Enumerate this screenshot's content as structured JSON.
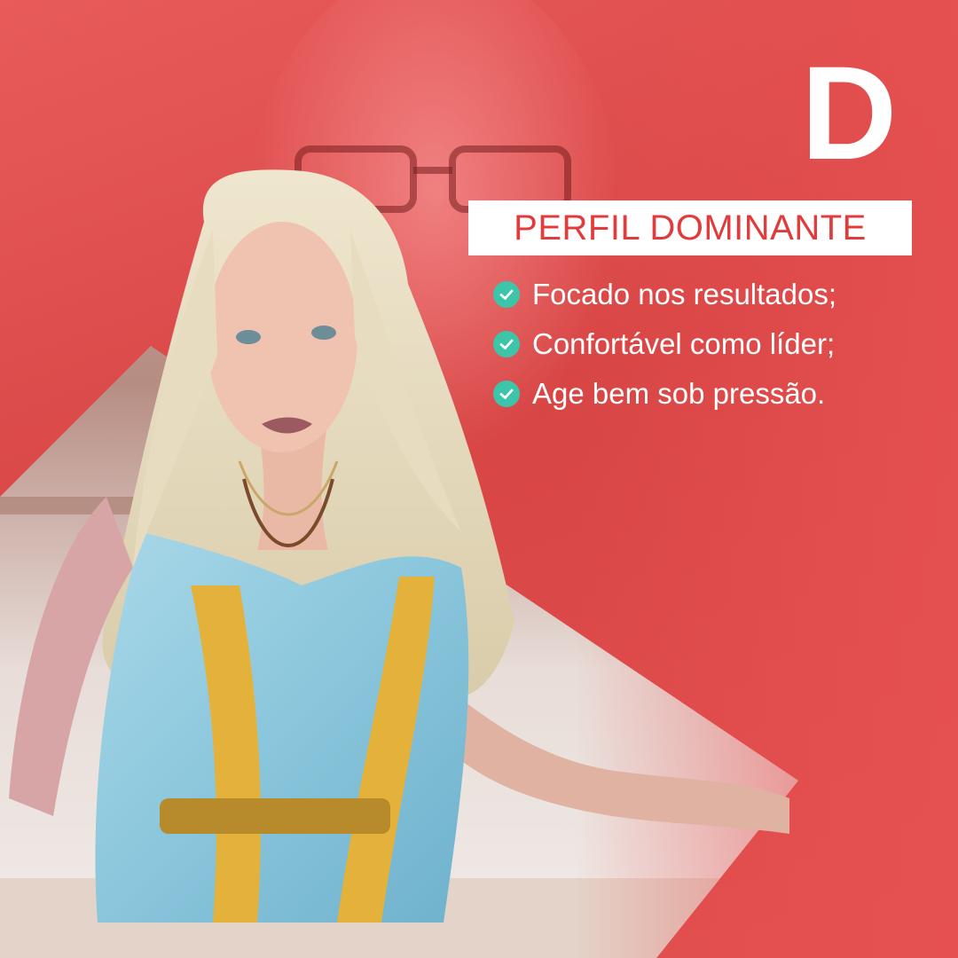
{
  "badge": {
    "letter": "D"
  },
  "title": "PERFIL DOMINANTE",
  "bullets": [
    {
      "text": "Focado nos resultados;",
      "icon": "check-circle-icon"
    },
    {
      "text": "Confortável como líder;",
      "icon": "check-circle-icon"
    },
    {
      "text": "Age bem sob pressão.",
      "icon": "check-circle-icon"
    }
  ],
  "colors": {
    "accent_red": "#e23b3b",
    "check_green": "#3cc5a8",
    "background_red": "#d94a4a",
    "white": "#ffffff"
  }
}
